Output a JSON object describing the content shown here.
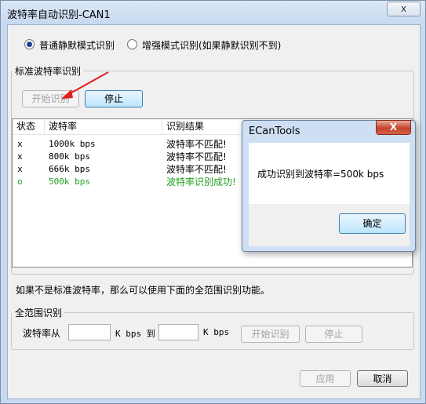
{
  "window": {
    "title": "波特率自动识别-CAN1",
    "close_label": "x"
  },
  "mode": {
    "options": [
      {
        "label": "普通静默模式识别",
        "selected": true
      },
      {
        "label": "增强模式识别(如果静默识别不到)",
        "selected": false
      }
    ]
  },
  "standard": {
    "group_label": "标准波特率识别",
    "start_button": "开始识别",
    "stop_button": "停止",
    "columns": [
      "状态",
      "波特率",
      "识别结果"
    ],
    "rows": [
      {
        "status": "x",
        "rate": "1000k bps",
        "result": "波特率不匹配!",
        "color": "#000000"
      },
      {
        "status": "x",
        "rate": "800k bps",
        "result": "波特率不匹配!",
        "color": "#000000"
      },
      {
        "status": "x",
        "rate": "666k bps",
        "result": "波特率不匹配!",
        "color": "#000000"
      },
      {
        "status": "o",
        "rate": "500k bps",
        "result": "波特率识别成功!",
        "color": "#22a022"
      }
    ]
  },
  "hint_text": "如果不是标准波特率，那么可以使用下面的全范围识别功能。",
  "full_range": {
    "group_label": "全范围识别",
    "from_label": "波特率从",
    "from_value": "",
    "unit1": "K bps 到",
    "to_value": "",
    "unit2": "K bps",
    "start_button": "开始识别",
    "stop_button": "停止"
  },
  "footer": {
    "apply_button": "应用",
    "cancel_button": "取消"
  },
  "popup": {
    "title": "ECanTools",
    "close_label": "X",
    "message": "成功识别到波特率=500k bps",
    "ok_button": "确定"
  },
  "colors": {
    "arrow": "#e02020",
    "success": "#22a022",
    "titlebar": "#c9daf0"
  }
}
